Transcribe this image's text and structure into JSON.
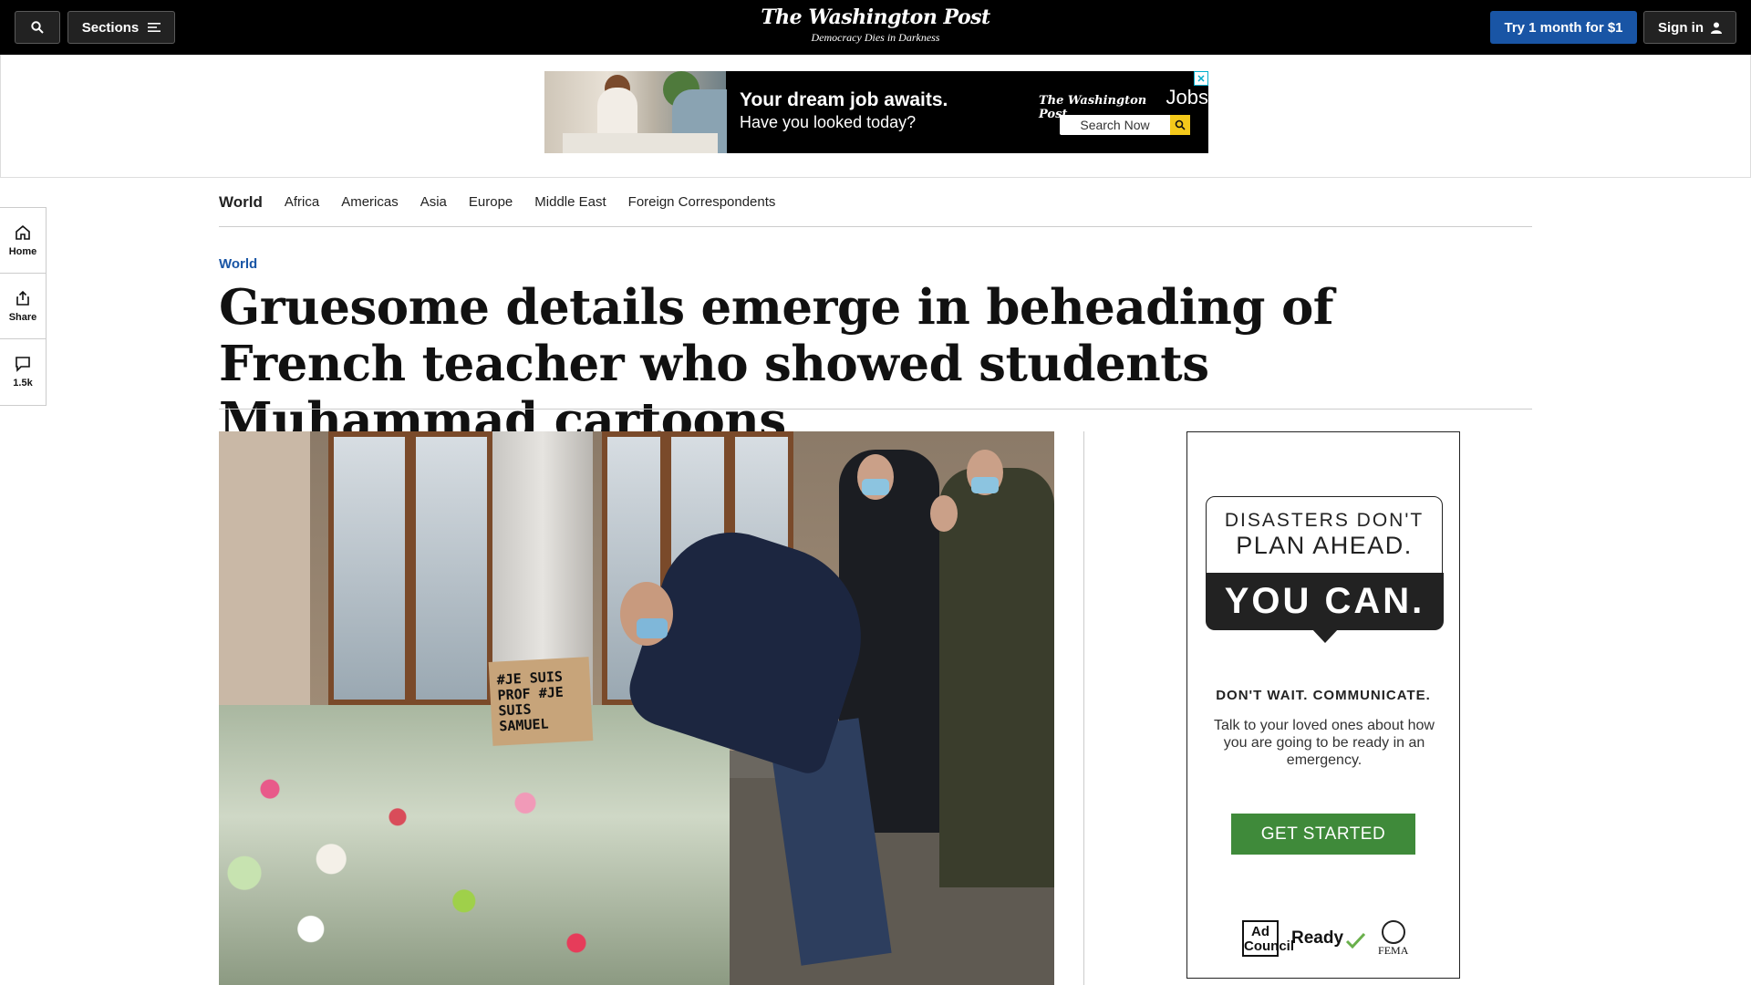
{
  "header": {
    "sections_label": "Sections",
    "logo": "The Washington Post",
    "tagline": "Democracy Dies in Darkness",
    "subscribe_label": "Try 1 month for $1",
    "signin_label": "Sign in"
  },
  "top_ad": {
    "headline": "Your dream job awaits.",
    "subline": "Have you looked today?",
    "brand": "The Washington Post",
    "brand_suffix": "Jobs",
    "search_label": "Search Now"
  },
  "subnav": {
    "items": [
      "World",
      "Africa",
      "Americas",
      "Asia",
      "Europe",
      "Middle East",
      "Foreign Correspondents"
    ]
  },
  "rail": {
    "home_label": "Home",
    "share_label": "Share",
    "comments_count": "1.5k"
  },
  "article": {
    "kicker": "World",
    "headline": "Gruesome details emerge in beheading of French teacher who showed students Muhammad cartoons",
    "photo_sign_text": "#JE SUIS PROF #JE SUIS SAMUEL"
  },
  "side_ad": {
    "line1": "DISASTERS DON'T",
    "line2": "PLAN AHEAD.",
    "line3": "YOU CAN.",
    "cta_heading": "DON'T WAIT. COMMUNICATE.",
    "body": "Talk to your loved ones about how you are going to be ready in an emergency.",
    "button_label": "GET STARTED",
    "logo_adcouncil": "Ad Council",
    "logo_ready": "Ready",
    "logo_fema": "FEMA"
  },
  "colors": {
    "topbar_bg": "#000000",
    "accent_blue": "#1955a5",
    "ad_button_green": "#3f8a3a",
    "ad_search_yellow": "#f4c91b"
  }
}
